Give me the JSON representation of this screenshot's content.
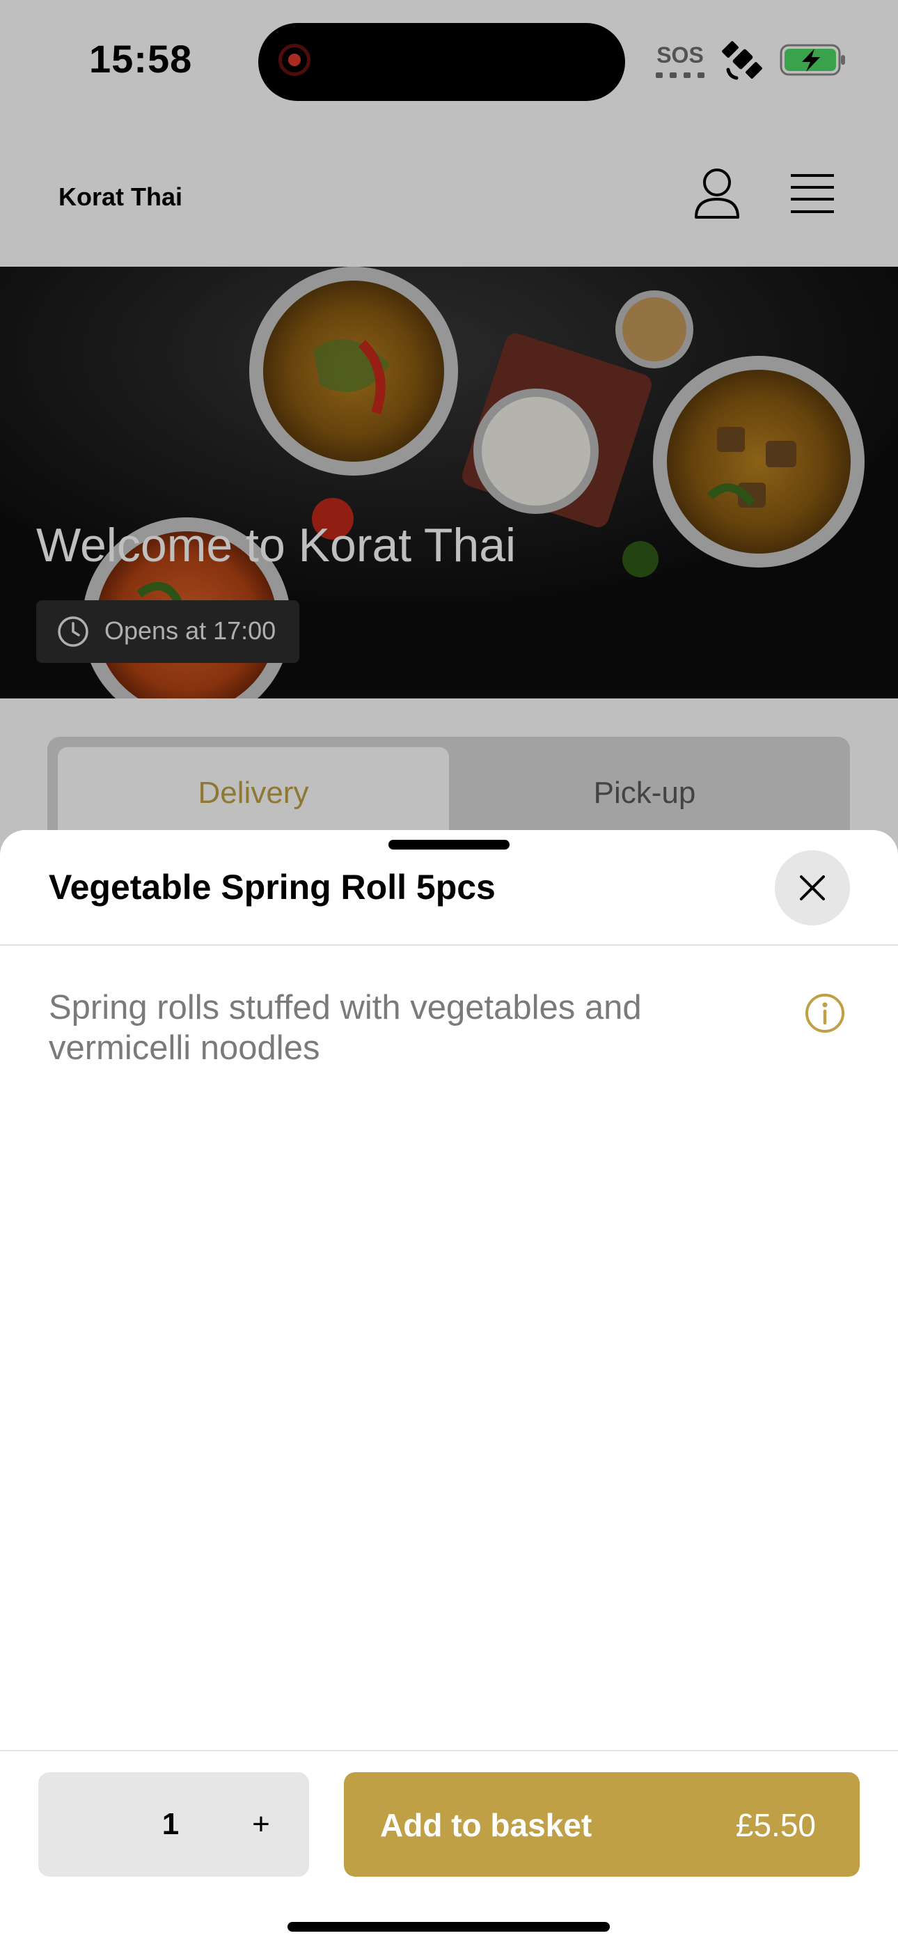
{
  "status_bar": {
    "time": "15:58",
    "sos_label": "SOS",
    "icons": [
      "screen-recording-icon",
      "sos-icon",
      "satellite-icon",
      "battery-charging-icon"
    ],
    "battery_color": "#4cd964"
  },
  "header": {
    "brand": "Korat Thai",
    "icons": [
      "profile-icon",
      "menu-icon"
    ]
  },
  "hero": {
    "headline": "Welcome to Korat Thai",
    "hours": "Opens at 17:00",
    "icon": "clock-icon"
  },
  "order_mode_tabs": {
    "tabs": [
      {
        "label": "Delivery",
        "selected": true
      },
      {
        "label": "Pick-up",
        "selected": false
      }
    ]
  },
  "item_sheet": {
    "title": "Vegetable Spring Roll 5pcs",
    "description": "Spring rolls stuffed with vegetables and vermicelli noodles",
    "close_icon": "close-icon",
    "info_icon": "info-icon"
  },
  "footer": {
    "quantity": "1",
    "increment_label": "+",
    "add_label": "Add to basket",
    "price": "£5.50"
  },
  "colors": {
    "accent": "#bfa046",
    "hero_bg": "#0d0d0d",
    "overlay": "rgba(0,0,0,0.25)"
  }
}
